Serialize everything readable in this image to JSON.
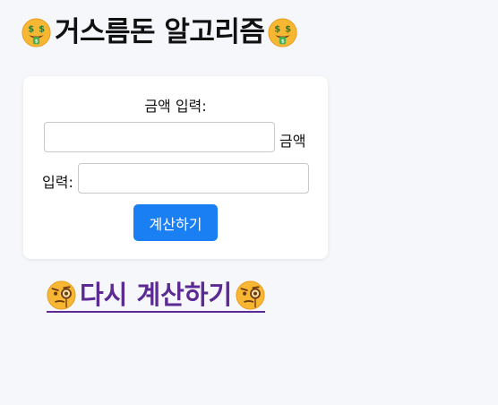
{
  "header": {
    "title": "거스름돈 알고리즘",
    "left_icon": "money-mouth-face-icon",
    "right_icon": "money-mouth-face-icon"
  },
  "form": {
    "prompt_label": "금액 입력:",
    "amount_input_value": "",
    "amount_suffix_label": "금액",
    "second_prefix_label": "입력:",
    "second_input_value": "",
    "submit_label": "계산하기"
  },
  "retry": {
    "label": "다시 계산하기",
    "left_icon": "face-with-monocle-icon",
    "right_icon": "face-with-monocle-icon"
  },
  "colors": {
    "background": "#f6f7fb",
    "card": "#ffffff",
    "button": "#1a7ff2",
    "link": "#5b2a93"
  }
}
